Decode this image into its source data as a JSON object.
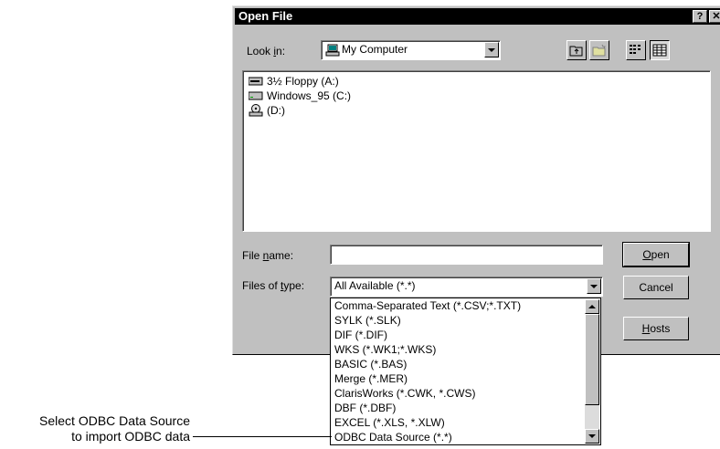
{
  "dialog": {
    "title": "Open File",
    "help_button": "?",
    "close_button": "✕",
    "look_in": {
      "label_pre": "Look ",
      "label_key": "i",
      "label_post": "n:",
      "value": "My Computer"
    },
    "files": [
      {
        "label": "3½ Floppy (A:)",
        "icon": "floppy-drive-icon"
      },
      {
        "label": "Windows_95 (C:)",
        "icon": "hard-drive-icon"
      },
      {
        "label": "(D:)",
        "icon": "cd-drive-icon"
      }
    ],
    "file_name": {
      "label_pre": "File ",
      "label_key": "n",
      "label_post": "ame:",
      "value": ""
    },
    "files_of_type": {
      "label_pre": "Files of ",
      "label_key": "t",
      "label_post": "ype:",
      "value": "All Available (*.*)"
    },
    "buttons": {
      "open": {
        "key": "O",
        "rest": "pen"
      },
      "cancel": "Cancel",
      "hosts": {
        "key": "H",
        "rest": "osts"
      }
    }
  },
  "type_options": [
    "Comma-Separated Text (*.CSV;*.TXT)",
    "SYLK (*.SLK)",
    "DIF (*.DIF)",
    "WKS (*.WK1;*.WKS)",
    "BASIC (*.BAS)",
    "Merge (*.MER)",
    "ClarisWorks (*.CWK, *.CWS)",
    "DBF (*.DBF)",
    "EXCEL (*.XLS, *.XLW)",
    "ODBC Data Source (*.*)"
  ],
  "callout": {
    "line1": "Select ODBC Data Source",
    "line2": "to import ODBC data"
  }
}
